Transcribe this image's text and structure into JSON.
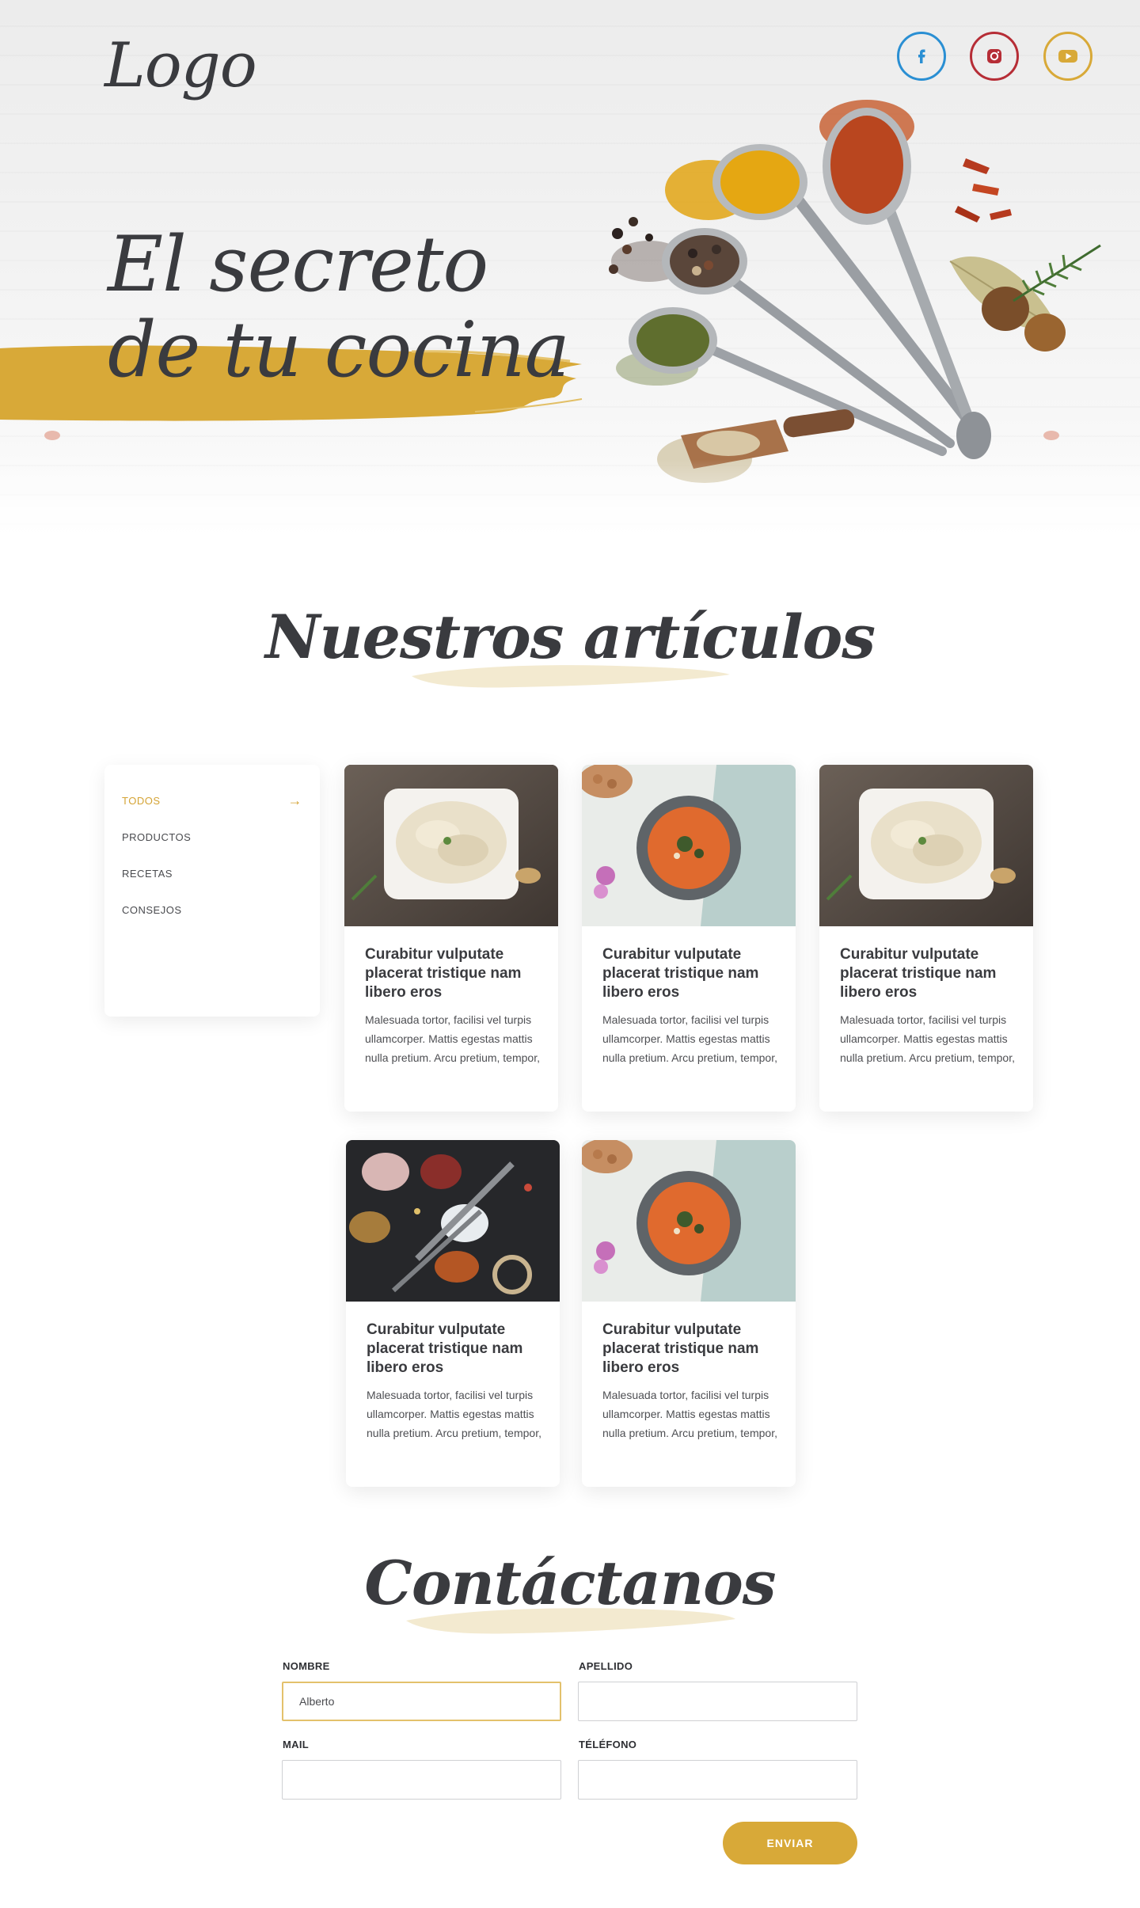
{
  "header": {
    "logo": "Logo",
    "social": [
      {
        "name": "facebook",
        "icon": "facebook-icon",
        "color": "#2a8fd3"
      },
      {
        "name": "instagram",
        "icon": "instagram-icon",
        "color": "#b62d36"
      },
      {
        "name": "youtube",
        "icon": "youtube-icon",
        "color": "#d8a938"
      }
    ]
  },
  "hero": {
    "title_line1": "El secreto",
    "title_line2": "de tu cocina",
    "brush_color": "#d8a938"
  },
  "articles": {
    "title": "Nuestros artículos",
    "filters": [
      {
        "label": "TODOS",
        "active": true
      },
      {
        "label": "PRODUCTOS",
        "active": false
      },
      {
        "label": "RECETAS",
        "active": false
      },
      {
        "label": "CONSEJOS",
        "active": false
      }
    ],
    "cards": [
      {
        "image": "creamy-dish-image",
        "title": "Curabitur vulputate placerat tristique nam libero eros",
        "text": "Malesuada tortor, facilisi vel turpis ullamcorper. Mattis egestas mattis nulla pretium. Arcu pretium, tempor,"
      },
      {
        "image": "tomato-soup-image",
        "title": "Curabitur vulputate placerat tristique nam libero eros",
        "text": "Malesuada tortor, facilisi vel turpis ullamcorper. Mattis egestas mattis nulla pretium. Arcu pretium, tempor,"
      },
      {
        "image": "creamy-dish-image",
        "title": "Curabitur vulputate placerat tristique nam libero eros",
        "text": "Malesuada tortor, facilisi vel turpis ullamcorper. Mattis egestas mattis nulla pretium. Arcu pretium, tempor,"
      },
      {
        "image": "spices-spoons-image",
        "title": "Curabitur vulputate placerat tristique nam libero eros",
        "text": "Malesuada tortor, facilisi vel turpis ullamcorper. Mattis egestas mattis nulla pretium. Arcu pretium, tempor,"
      },
      {
        "image": "tomato-soup-image",
        "title": "Curabitur vulputate placerat tristique nam libero eros",
        "text": "Malesuada tortor, facilisi vel turpis ullamcorper. Mattis egestas mattis nulla pretium. Arcu pretium, tempor,"
      }
    ]
  },
  "contact": {
    "title": "Contáctanos",
    "fields": {
      "nombre": {
        "label": "NOMBRE",
        "value": "Alberto"
      },
      "apellido": {
        "label": "APELLIDO",
        "value": ""
      },
      "mail": {
        "label": "MAIL",
        "value": ""
      },
      "telefono": {
        "label": "TÉLÉFONO",
        "value": ""
      }
    },
    "submit_label": "ENVIAR"
  },
  "colors": {
    "accent": "#d8a938",
    "text": "#3a3b3f",
    "facebook": "#2a8fd3",
    "instagram": "#b62d36"
  }
}
